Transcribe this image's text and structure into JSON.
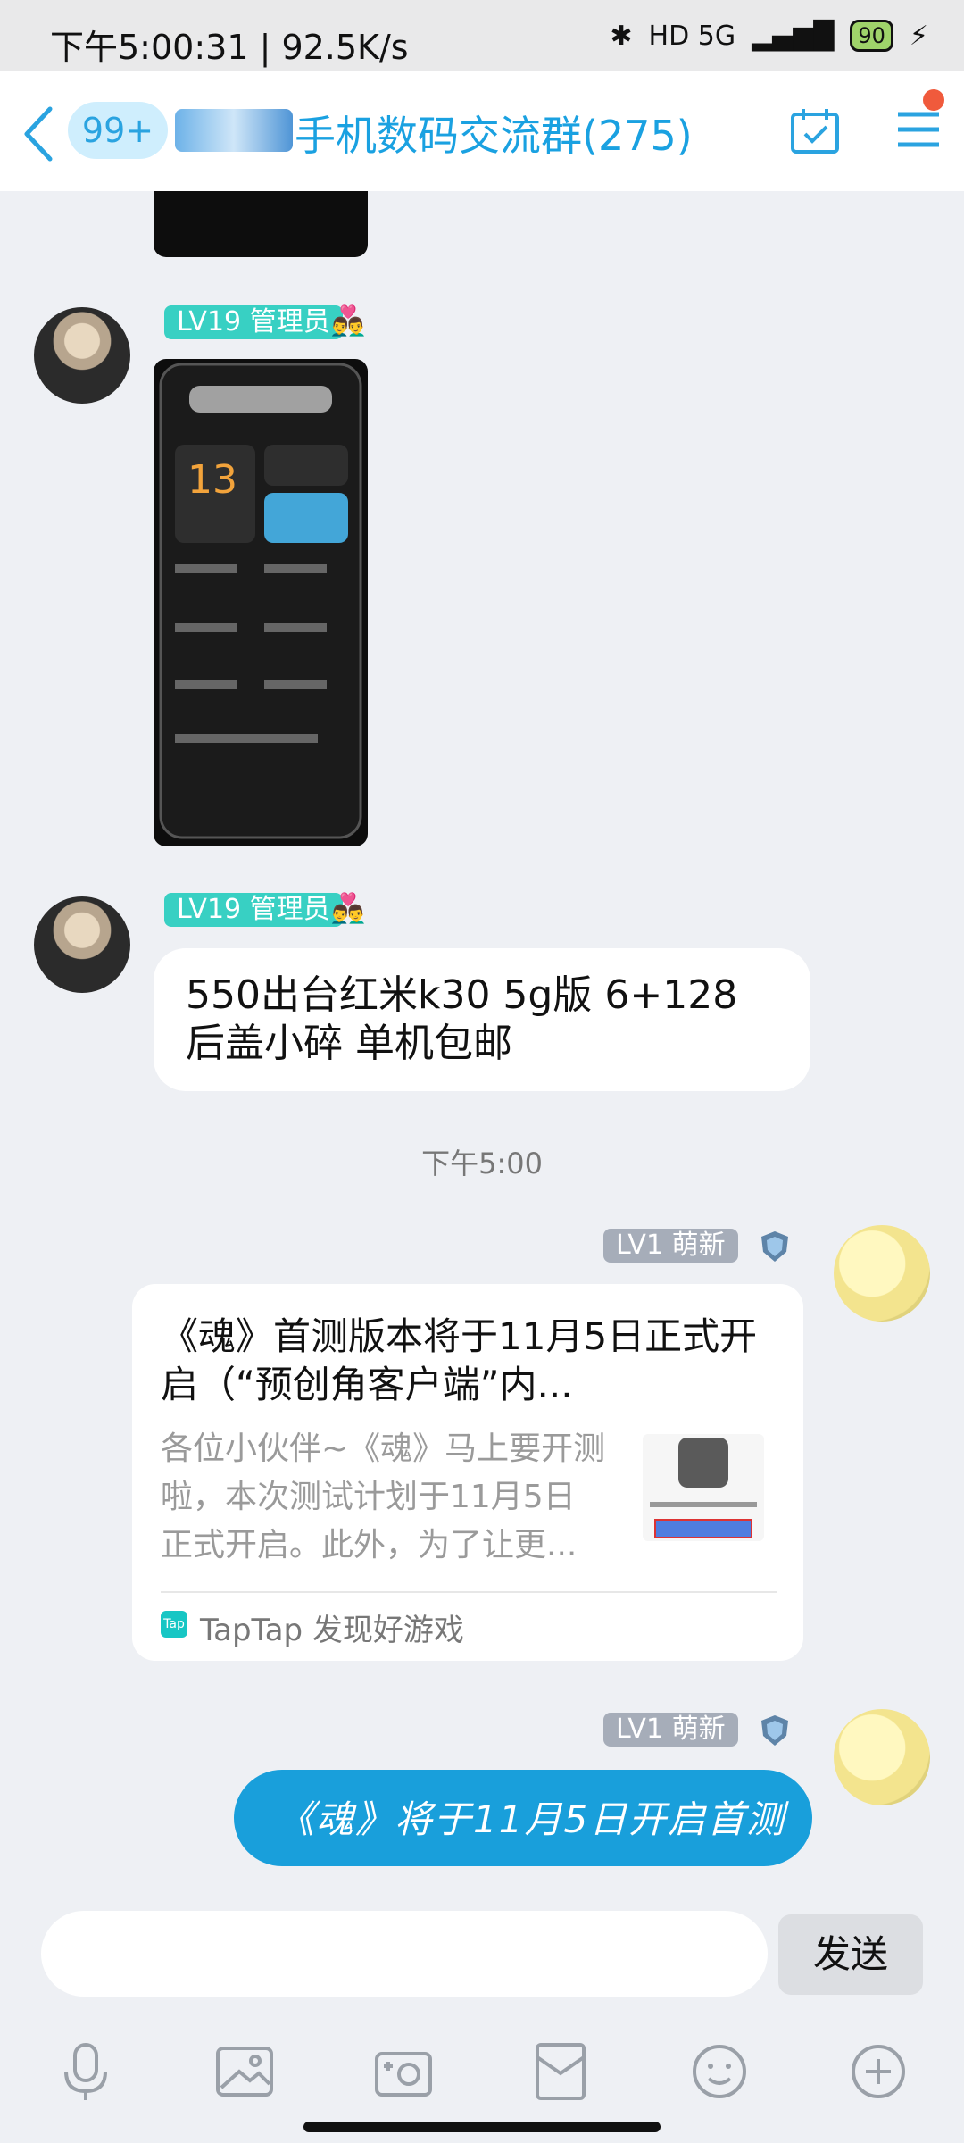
{
  "status_bar": {
    "time_speed": "下午5:00:31 | 92.5K/s",
    "network": "HD 5G",
    "battery": "90"
  },
  "header": {
    "back_icon": "chevron-left-icon",
    "unread_count": "99+",
    "group_name": "手机数码交流群(275)",
    "calendar_icon": "calendar-check-icon",
    "menu_icon": "hamburger-menu-icon",
    "accent_color": "#1aa1e1"
  },
  "messages": {
    "admin_level": "LV19",
    "admin_role": "管理员",
    "admin_emoji": "👨‍❤️‍👨",
    "sale_text": "550出台红米k30 5g版 6+128 后盖小碎 单机包邮",
    "timestamp": "下午5:00",
    "new_level": "LV1",
    "new_role": "萌新",
    "card": {
      "title": "《魂》首测版本将于11月5日正式开启（“预创角客户端”内...",
      "description": "各位小伙伴~《魂》马上要开测啦，本次测试计划于11月5日正式开启。此外，为了让更...",
      "source_badge": "Tap",
      "source": "TapTap 发现好游戏"
    },
    "my_text": "《魂》将于11月5日开启首测"
  },
  "input": {
    "placeholder": "",
    "send_label": "发送"
  },
  "toolbar": [
    "microphone-icon",
    "image-icon",
    "camera-icon",
    "red-packet-icon",
    "emoji-icon",
    "plus-icon"
  ]
}
